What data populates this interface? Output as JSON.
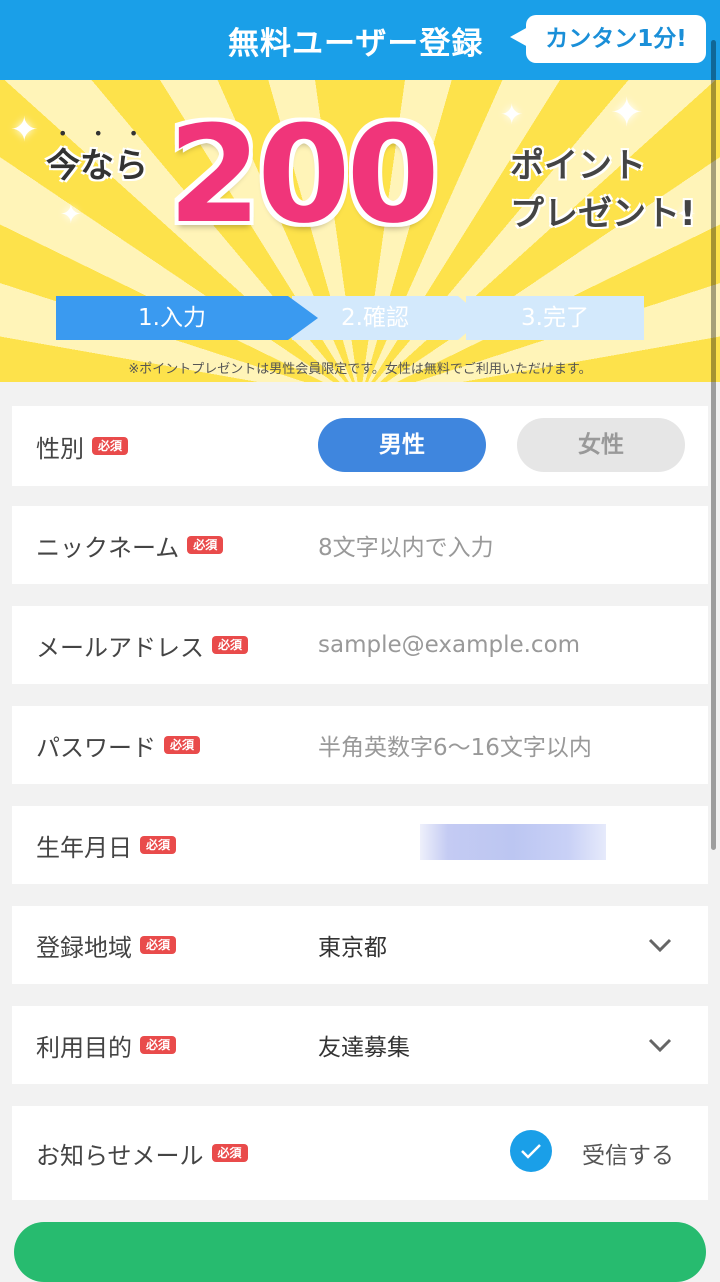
{
  "header": {
    "title": "無料ユーザー登録",
    "badge": "カンタン1分!"
  },
  "banner": {
    "prefix": "今なら",
    "number": "200",
    "suffix_line1": "ポイント",
    "suffix_line2": "プレゼント!",
    "steps": [
      "1.入力",
      "2.確認",
      "3.完了"
    ],
    "note": "※ポイントプレゼントは男性会員限定です。女性は無料でご利用いただけます。"
  },
  "form": {
    "required_label": "必須",
    "gender": {
      "label": "性別",
      "options": [
        "男性",
        "女性"
      ],
      "selected": "男性"
    },
    "nickname": {
      "label": "ニックネーム",
      "placeholder": "8文字以内で入力"
    },
    "email": {
      "label": "メールアドレス",
      "placeholder": "sample@example.com"
    },
    "password": {
      "label": "パスワード",
      "placeholder": "半角英数字6〜16文字以内"
    },
    "birthday": {
      "label": "生年月日"
    },
    "region": {
      "label": "登録地域",
      "value": "東京都"
    },
    "purpose": {
      "label": "利用目的",
      "value": "友達募集"
    },
    "newsletter": {
      "label": "お知らせメール",
      "option": "受信する",
      "checked": true
    }
  },
  "colors": {
    "header_bg": "#1a9fe8",
    "accent_pink": "#f0357a",
    "primary_blue": "#3f86de",
    "required_red": "#e94b4b",
    "submit_green": "#27bb6f"
  },
  "icons": [
    "chevron-down-icon",
    "checkmark-icon"
  ]
}
